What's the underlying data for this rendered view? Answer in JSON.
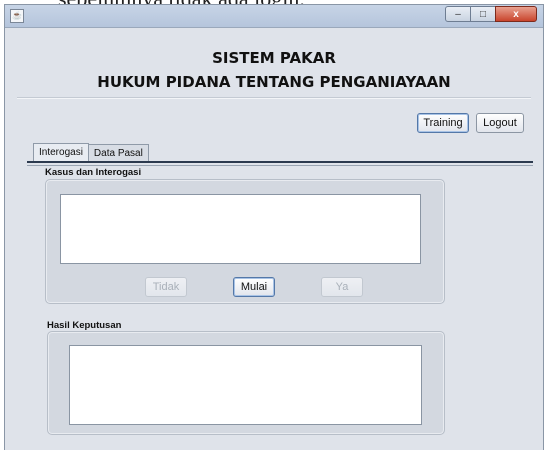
{
  "doc_caption": "sebelumnya tidak ada login.",
  "window": {
    "buttons": {
      "minimize": "–",
      "maximize": "□",
      "close": "x"
    }
  },
  "header": {
    "line1": "SISTEM PAKAR",
    "line2": "HUKUM PIDANA TENTANG PENGANIAYAAN"
  },
  "toolbar": {
    "training_label": "Training",
    "logout_label": "Logout"
  },
  "tabs": [
    {
      "label": "Interogasi",
      "active": true
    },
    {
      "label": "Data Pasal",
      "active": false
    }
  ],
  "interogasi": {
    "group_label": "Kasus dan Interogasi",
    "text_value": "",
    "buttons": {
      "tidak": "Tidak",
      "mulai": "Mulai",
      "ya": "Ya"
    }
  },
  "hasil": {
    "group_label": "Hasil Keputusan",
    "text_value": ""
  }
}
